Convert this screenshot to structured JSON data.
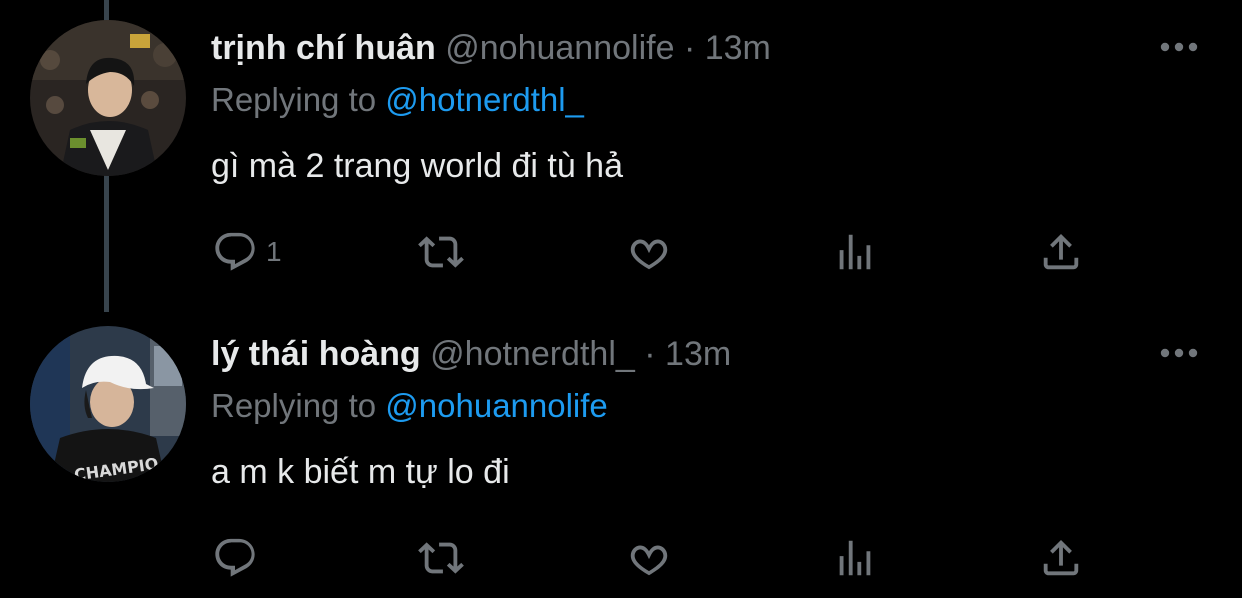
{
  "tweets": [
    {
      "display_name": "trịnh chí huân",
      "handle": "@nohuannolife",
      "separator": "·",
      "time": "13m",
      "replying_prefix": "Replying to",
      "replying_to": "@hotnerdthl_",
      "text": "gì mà 2 trang world đi tù hả",
      "reply_count": "1",
      "avatar_icon": "user-avatar-photo"
    },
    {
      "display_name": "lý thái hoàng",
      "handle": "@hotnerdthl_",
      "separator": "·",
      "time": "13m",
      "replying_prefix": "Replying to",
      "replying_to": "@nohuannolife",
      "text": "a m k biết m tự lo đi",
      "reply_count": "",
      "avatar_icon": "user-avatar-photo"
    }
  ],
  "icons": {
    "more": "more-icon",
    "reply": "reply-icon",
    "retweet": "retweet-icon",
    "like": "heart-icon",
    "analytics": "analytics-icon",
    "share": "share-icon"
  },
  "colors": {
    "background": "#000000",
    "primary_text": "#e7e9ea",
    "secondary_text": "#71767b",
    "accent": "#1d9bf0",
    "thread_line": "#38444d"
  }
}
